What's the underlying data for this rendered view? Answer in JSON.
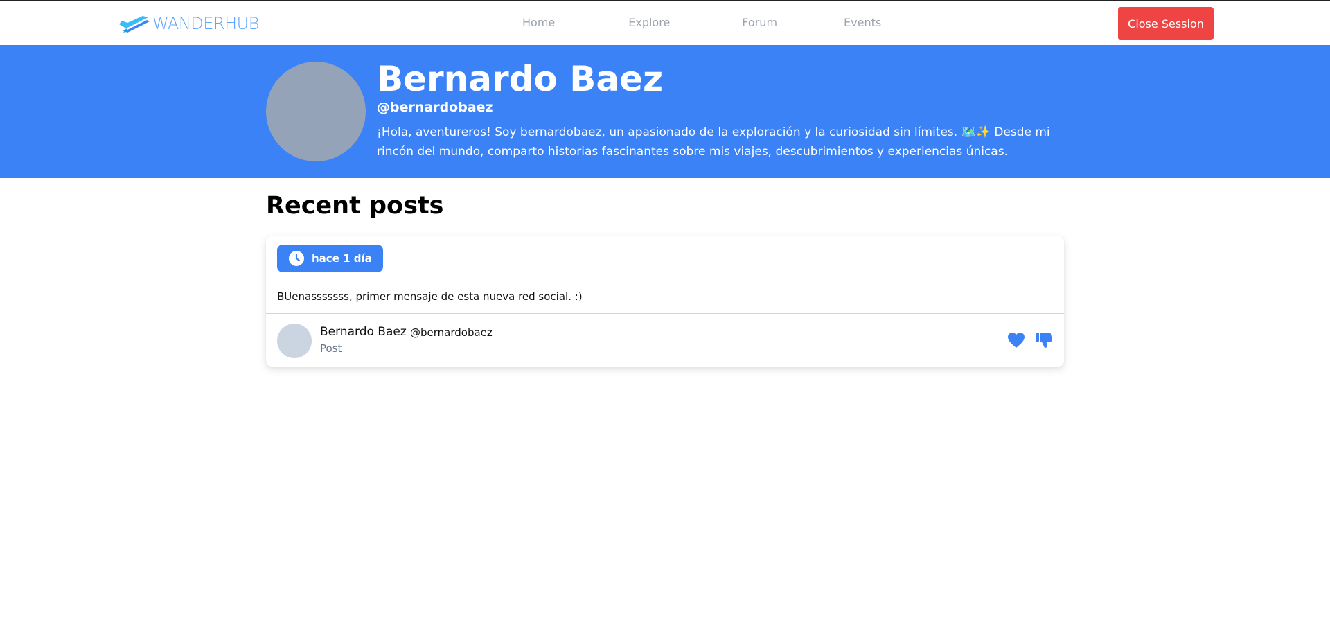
{
  "navbar": {
    "brand": "WANDERHUB",
    "links": [
      "Home",
      "Explore",
      "Forum",
      "Events"
    ],
    "close_session_label": "Close Session"
  },
  "profile": {
    "name": "Bernardo Baez",
    "handle": "@bernardobaez",
    "bio": "¡Hola, aventureros! Soy bernardobaez, un apasionado de la exploración y la curiosidad sin límites. 🗺️✨ Desde mi rincón del mundo, comparto historias fascinantes sobre mis viajes, descubrimientos y experiencias únicas."
  },
  "recent_posts": {
    "title": "Recent posts",
    "posts": [
      {
        "time_label": "hace 1 día",
        "text": "BUenasssssss, primer mensaje de esta nueva red social. :)",
        "author_name": "Bernardo Baez",
        "author_handle": "@bernardobaez",
        "type": "Post"
      }
    ]
  },
  "icons": {
    "brand": "plane-logo-icon",
    "time": "clock-icon",
    "like": "heart-icon",
    "dislike": "thumbs-down-icon"
  },
  "colors": {
    "primary": "#3b82f6",
    "danger": "#ef4444",
    "brand_text": "#60a5fa",
    "avatar_large": "#94a3b8",
    "avatar_small": "#cbd5e1"
  }
}
